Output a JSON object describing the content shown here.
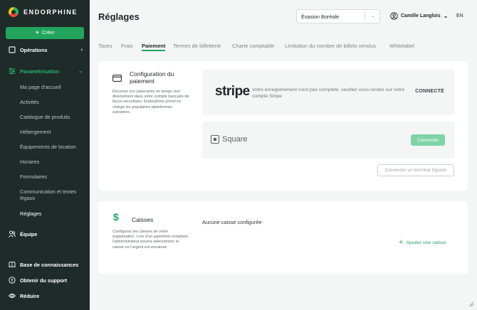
{
  "brand": {
    "name": "ENDORPHINE"
  },
  "sidebar": {
    "create_label": "Créer",
    "operations_label": "Opérations",
    "parametrisation_label": "Paramétrisation",
    "sub_items": [
      {
        "label": "Ma page d'accueil"
      },
      {
        "label": "Activités"
      },
      {
        "label": "Catalogue de produits"
      },
      {
        "label": "Hébergement"
      },
      {
        "label": "Équipements de location"
      },
      {
        "label": "Horaires"
      },
      {
        "label": "Formulaires"
      },
      {
        "label": "Communication et textes légaux"
      },
      {
        "label": "Réglages"
      }
    ],
    "equipe_label": "Équipe",
    "bottom": {
      "knowledge_label": "Base de connaissances",
      "support_label": "Obtenir du support",
      "reduce_label": "Réduire"
    }
  },
  "header": {
    "title": "Réglages",
    "organization": "Évasion Boréale",
    "user_name": "Camille Langlois",
    "language": "EN"
  },
  "tabs": [
    {
      "label": "Taxes"
    },
    {
      "label": "Frais"
    },
    {
      "label": "Paiement"
    },
    {
      "label": "Termes de billetterie"
    },
    {
      "label": "Charte comptable"
    },
    {
      "label": "Limitation du nombre de billets vendus"
    },
    {
      "label": "Whitelabel"
    }
  ],
  "payment": {
    "title": "Configuration du paiement",
    "description": "Recevez vos paiements en temps réel directement dans votre compte bancaire de façon sécuritaire. Endorphine prend en charge les populaires plateformes suivantes.",
    "stripe": {
      "logo_text": "stripe",
      "message": "Votre enregistrement n'est pas complété, veuillez vous rendre sur votre compte Stripe",
      "status": "CONNECTÉ"
    },
    "square": {
      "logo_text": "Square",
      "connect_label": "Connecter"
    },
    "terminal_label": "Connecter un terminal Square"
  },
  "caisses": {
    "title": "Caisses",
    "description": "Configurez les caisses de votre organisation. Lors d'un paiement comptant, l'administrateur pourra sélectionner la caisse où l'argent est encaissé.",
    "empty_text": "Aucune caisse configurée",
    "add_label": "Ajouter une caisse"
  },
  "colors": {
    "sidebar_bg": "#1f2b29",
    "accent": "#22a45d",
    "page_bg": "#f4f5f5"
  }
}
